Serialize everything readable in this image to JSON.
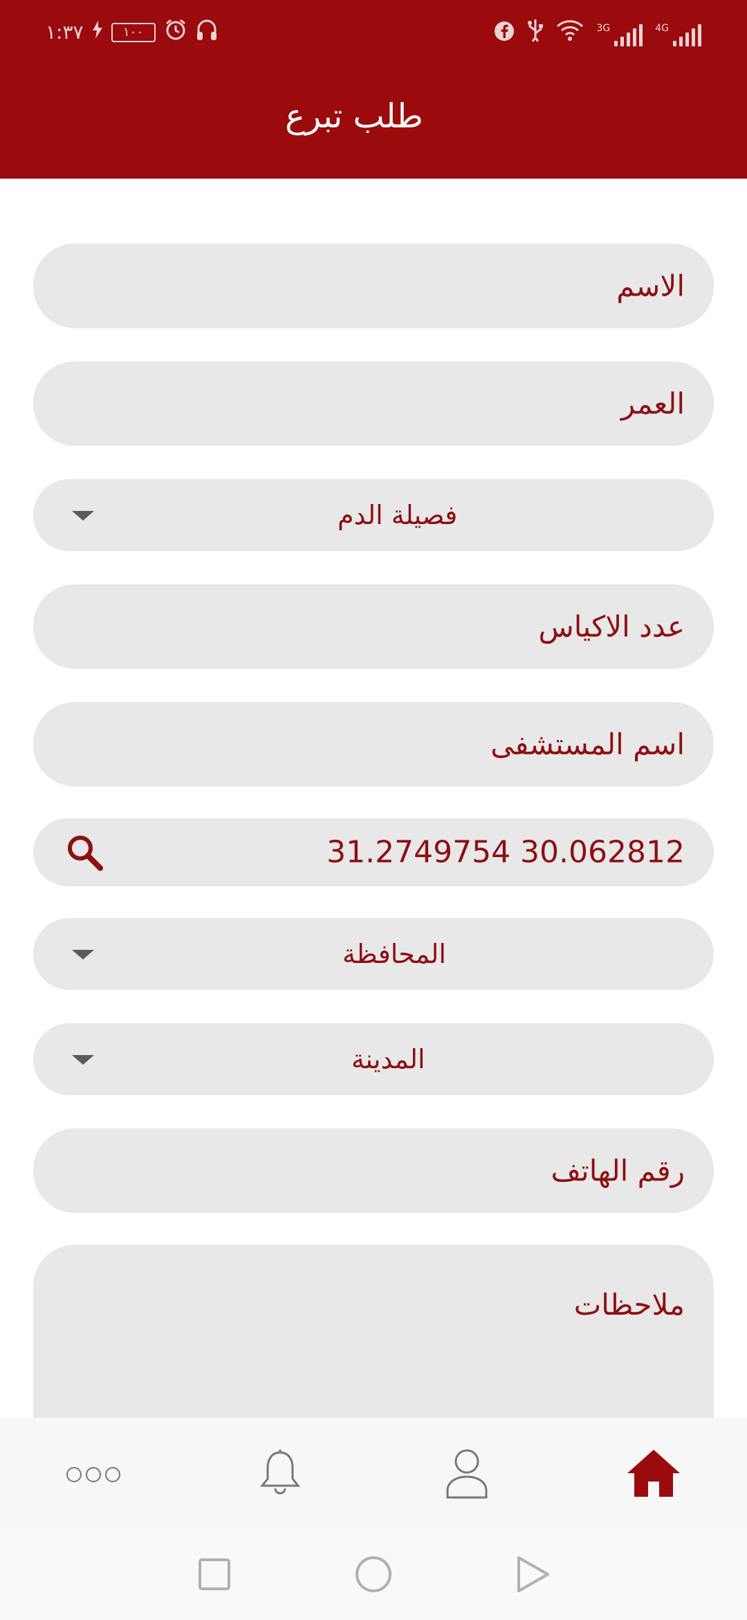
{
  "status_bar": {
    "time": "١:٣٧",
    "battery": "١٠٠",
    "network_3g": "3G",
    "network_4g": "4G"
  },
  "header": {
    "title": "طلب تبرع"
  },
  "form": {
    "name_placeholder": "الاسم",
    "age_placeholder": "العمر",
    "blood_type_label": "فصيلة الدم",
    "bags_count_placeholder": "عدد الاكياس",
    "hospital_name_placeholder": "اسم المستشفى",
    "location_value": "31.2749754 30.062812",
    "governorate_label": "المحافظة",
    "city_label": "المدينة",
    "phone_placeholder": "رقم الهاتف",
    "notes_placeholder": "ملاحظات"
  },
  "bottom_nav": {
    "items": [
      {
        "icon": "more-icon"
      },
      {
        "icon": "bell-icon"
      },
      {
        "icon": "profile-icon"
      },
      {
        "icon": "home-icon",
        "active": true
      }
    ]
  },
  "colors": {
    "primary": "#9b0b0d",
    "field_bg": "#e8e8e8",
    "field_text": "#8d0f12",
    "nav_bg": "#f7f7f7"
  }
}
